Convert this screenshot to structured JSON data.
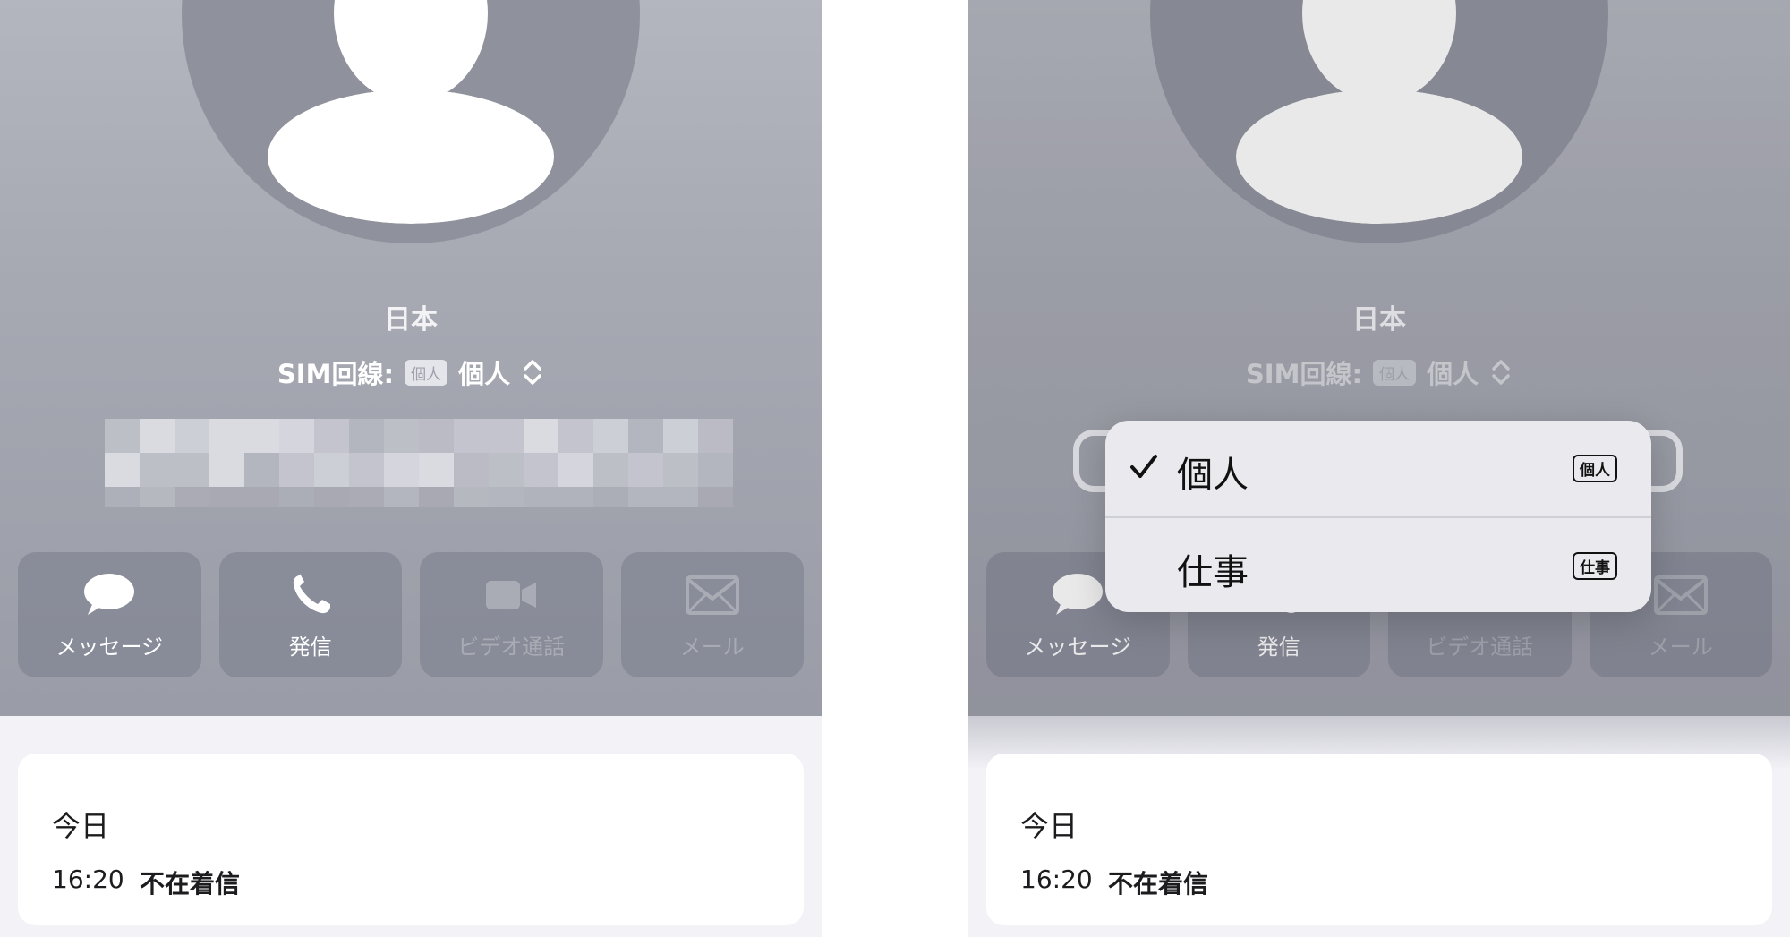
{
  "contact": {
    "country": "日本",
    "sim_label": "SIM回線:",
    "sim_badge": "個人",
    "sim_value": "個人"
  },
  "actions": [
    {
      "label": "メッセージ",
      "icon": "speech-bubble-icon",
      "enabled": true
    },
    {
      "label": "発信",
      "icon": "phone-icon",
      "enabled": true
    },
    {
      "label": "ビデオ通話",
      "icon": "video-camera-icon",
      "enabled": false
    },
    {
      "label": "メール",
      "icon": "envelope-icon",
      "enabled": false
    }
  ],
  "recent": {
    "day": "今日",
    "time": "16:20",
    "status": "不在着信"
  },
  "sim_menu": {
    "items": [
      {
        "label": "個人",
        "badge": "個人",
        "selected": true
      },
      {
        "label": "仕事",
        "badge": "仕事",
        "selected": false
      }
    ]
  },
  "colors": {
    "header": "#a6a8b2",
    "action_button": "#8a8d99",
    "card": "#ffffff",
    "menu": "#e9e9ee"
  }
}
